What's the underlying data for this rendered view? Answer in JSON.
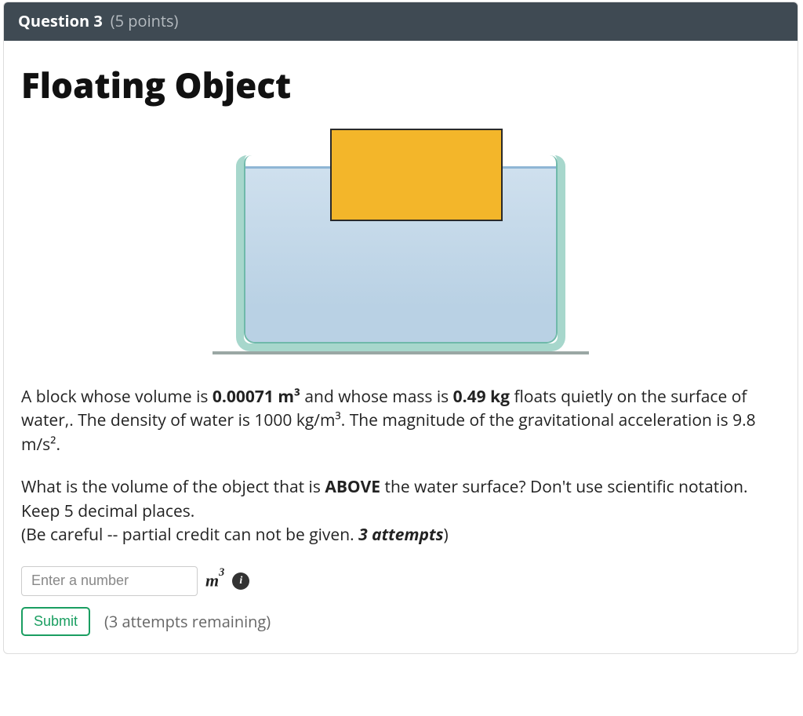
{
  "header": {
    "question_label": "Question 3",
    "points_label": "(5 points)"
  },
  "title": "Floating Object",
  "problem": {
    "line1_a": "A block whose volume is ",
    "volume": "0.00071 m³",
    "line1_b": " and whose mass is ",
    "mass": "0.49 kg",
    "line1_c": " floats  quietly on the surface of water,. The density of water is 1000 kg/m³. The magnitude of the gravitational acceleration is 9.8 m/s².",
    "line2_a": "What is the volume of the object that is ",
    "above": "ABOVE",
    "line2_b": " the water surface? Don't use scientific notation. Keep 5 decimal places.",
    "line3_a": "(Be careful -- partial credit can not be given. ",
    "attempts_bold": "3 attempts",
    "line3_b": ")"
  },
  "answer": {
    "placeholder": "Enter a number",
    "unit_html": "m³",
    "info_tooltip": "i"
  },
  "submit": {
    "label": "Submit",
    "remaining": "(3 attempts remaining)"
  }
}
